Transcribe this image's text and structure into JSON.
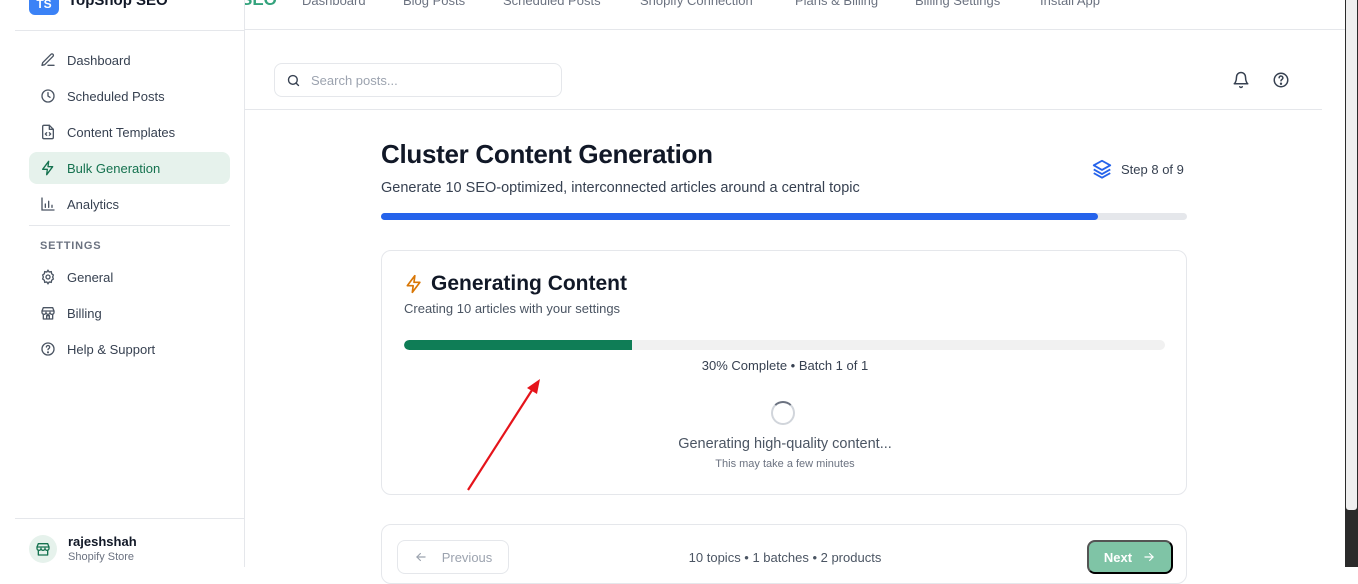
{
  "app": {
    "logo_text": "TS",
    "name": "TopShop SEO",
    "brand_fragment": "SEO"
  },
  "topnav": [
    "Dashboard",
    "Blog Posts",
    "Scheduled Posts",
    "Shopify Connection",
    "Plans & Billing",
    "Billing Settings",
    "Install App"
  ],
  "sidebar": {
    "items": [
      {
        "label": "Dashboard",
        "icon": "edit-icon"
      },
      {
        "label": "Scheduled Posts",
        "icon": "clock-icon"
      },
      {
        "label": "Content Templates",
        "icon": "file-code-icon"
      },
      {
        "label": "Bulk Generation",
        "icon": "lightning-icon",
        "active": true
      },
      {
        "label": "Analytics",
        "icon": "bar-chart-icon"
      }
    ],
    "settings_heading": "SETTINGS",
    "settings_items": [
      {
        "label": "General",
        "icon": "gear-icon"
      },
      {
        "label": "Billing",
        "icon": "store-icon"
      },
      {
        "label": "Help & Support",
        "icon": "help-circle-icon"
      }
    ],
    "user": {
      "name": "rajeshshah",
      "role": "Shopify Store"
    }
  },
  "header": {
    "search_placeholder": "Search posts..."
  },
  "main": {
    "title": "Cluster Content Generation",
    "subtitle": "Generate 10 SEO-optimized, interconnected articles around a central topic",
    "step_label": "Step 8 of 9",
    "step_progress": 0.889
  },
  "generation": {
    "title": "Generating Content",
    "subtitle": "Creating 10 articles with your settings",
    "progress": 0.3,
    "status": "30% Complete • Batch 1 of 1",
    "message": "Generating high-quality content...",
    "note": "This may take a few minutes"
  },
  "footer": {
    "prev_label": "Previous",
    "summary": "10 topics • 1 batches  • 2 products",
    "next_label": "Next"
  },
  "colors": {
    "accent_green": "#0f7d56",
    "progress_blue": "#2563eb",
    "annotation_red": "#e5141b"
  }
}
